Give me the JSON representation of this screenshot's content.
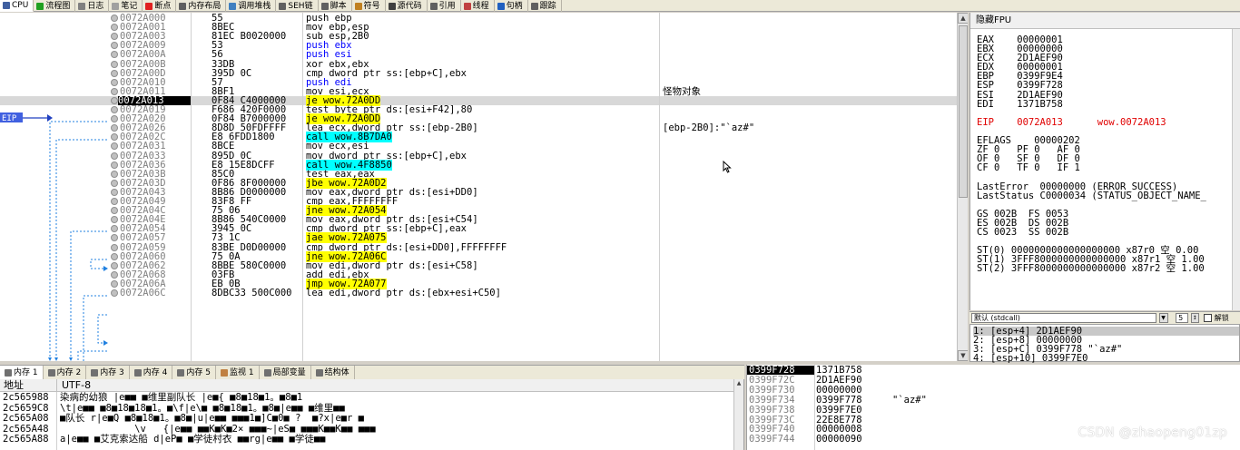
{
  "tabs": [
    {
      "label": "CPU",
      "icon": "cpu-icon",
      "color": "#4060a0"
    },
    {
      "label": "流程图",
      "icon": "graph-icon",
      "color": "#20a020"
    },
    {
      "label": "日志",
      "icon": "log-icon",
      "color": "#808080"
    },
    {
      "label": "笔记",
      "icon": "notes-icon",
      "color": "#a0a0a0"
    },
    {
      "label": "断点",
      "icon": "breakpoint-icon",
      "color": "#e02020"
    },
    {
      "label": "内存布局",
      "icon": "memory-map-icon",
      "color": "#606060"
    },
    {
      "label": "调用堆栈",
      "icon": "callstack-icon",
      "color": "#4080c0"
    },
    {
      "label": "SEH链",
      "icon": "seh-icon",
      "color": "#606060"
    },
    {
      "label": "脚本",
      "icon": "script-icon",
      "color": "#606060"
    },
    {
      "label": "符号",
      "icon": "symbol-icon",
      "color": "#c08020"
    },
    {
      "label": "源代码",
      "icon": "source-icon",
      "color": "#404040"
    },
    {
      "label": "引用",
      "icon": "references-icon",
      "color": "#606060"
    },
    {
      "label": "线程",
      "icon": "threads-icon",
      "color": "#c04040"
    },
    {
      "label": "句柄",
      "icon": "handles-icon",
      "color": "#2060c0"
    },
    {
      "label": "跟踪",
      "icon": "trace-icon",
      "color": "#606060"
    }
  ],
  "disasm": {
    "eip_label": "EIP",
    "rows": [
      {
        "addr": "0072A000",
        "bytes": "55",
        "ins": [
          {
            "t": "push ebp"
          }
        ],
        "comment": ""
      },
      {
        "addr": "0072A001",
        "bytes": "8BEC",
        "ins": [
          {
            "t": "mov ebp,esp"
          }
        ],
        "comment": ""
      },
      {
        "addr": "0072A003",
        "bytes": "81EC B0020000",
        "ins": [
          {
            "t": "sub esp,2B0"
          }
        ],
        "comment": ""
      },
      {
        "addr": "0072A009",
        "bytes": "53",
        "ins": [
          {
            "t": "push ebx",
            "c": "reg"
          }
        ],
        "comment": ""
      },
      {
        "addr": "0072A00A",
        "bytes": "56",
        "ins": [
          {
            "t": "push esi",
            "c": "reg"
          }
        ],
        "comment": ""
      },
      {
        "addr": "0072A00B",
        "bytes": "33DB",
        "ins": [
          {
            "t": "xor ebx,ebx"
          }
        ],
        "comment": ""
      },
      {
        "addr": "0072A00D",
        "bytes": "395D 0C",
        "ins": [
          {
            "t": "cmp dword ptr ss:[ebp+C],ebx"
          }
        ],
        "comment": ""
      },
      {
        "addr": "0072A010",
        "bytes": "57",
        "ins": [
          {
            "t": "push edi",
            "c": "reg"
          }
        ],
        "comment": ""
      },
      {
        "addr": "0072A011",
        "bytes": "8BF1",
        "ins": [
          {
            "t": "mov esi,ecx"
          }
        ],
        "comment": "怪物对象"
      },
      {
        "addr": "0072A013",
        "bytes": "0F84 C4000000",
        "ins": [
          {
            "t": "je",
            "c": "hly"
          },
          {
            "t": " wow.72A0DD",
            "c": "hly"
          }
        ],
        "comment": "",
        "eip": true
      },
      {
        "addr": "0072A019",
        "bytes": "F686 420F0000",
        "ins": [
          {
            "t": "test byte ptr ds:[esi+F42],80"
          }
        ],
        "comment": ""
      },
      {
        "addr": "0072A020",
        "bytes": "0F84 B7000000",
        "ins": [
          {
            "t": "je wow.72A0DD",
            "c": "hly"
          }
        ],
        "comment": ""
      },
      {
        "addr": "0072A026",
        "bytes": "8D8D 50FDFFFF",
        "ins": [
          {
            "t": "lea ecx,dword ptr ss:[ebp-2B0]"
          }
        ],
        "comment": "[ebp-2B0]:\"`az#\""
      },
      {
        "addr": "0072A02C",
        "bytes": "E8 6FDD1800",
        "ins": [
          {
            "t": "call wow.8B7DA0",
            "c": "hlc"
          }
        ],
        "comment": ""
      },
      {
        "addr": "0072A031",
        "bytes": "8BCE",
        "ins": [
          {
            "t": "mov ecx,esi"
          }
        ],
        "comment": ""
      },
      {
        "addr": "0072A033",
        "bytes": "895D 0C",
        "ins": [
          {
            "t": "mov dword ptr ss:[ebp+C],ebx"
          }
        ],
        "comment": ""
      },
      {
        "addr": "0072A036",
        "bytes": "E8 15E8DCFF",
        "ins": [
          {
            "t": "call wow.4F8850",
            "c": "hlc"
          }
        ],
        "comment": ""
      },
      {
        "addr": "0072A03B",
        "bytes": "85C0",
        "ins": [
          {
            "t": "test eax,eax"
          }
        ],
        "comment": ""
      },
      {
        "addr": "0072A03D",
        "bytes": "0F86 8F000000",
        "ins": [
          {
            "t": "jbe wow.72A0D2",
            "c": "hly"
          }
        ],
        "comment": ""
      },
      {
        "addr": "0072A043",
        "bytes": "8B86 D0000000",
        "ins": [
          {
            "t": "mov eax,dword ptr ds:[esi+DD0]"
          }
        ],
        "comment": ""
      },
      {
        "addr": "0072A049",
        "bytes": "83F8 FF",
        "ins": [
          {
            "t": "cmp eax,FFFFFFFF"
          }
        ],
        "comment": ""
      },
      {
        "addr": "0072A04C",
        "bytes": "75 06",
        "ins": [
          {
            "t": "jne wow.72A054",
            "c": "hly"
          }
        ],
        "comment": ""
      },
      {
        "addr": "0072A04E",
        "bytes": "8B86 540C0000",
        "ins": [
          {
            "t": "mov eax,dword ptr ds:[esi+C54]"
          }
        ],
        "comment": ""
      },
      {
        "addr": "0072A054",
        "bytes": "3945 0C",
        "ins": [
          {
            "t": "cmp dword ptr ss:[ebp+C],eax"
          }
        ],
        "comment": ""
      },
      {
        "addr": "0072A057",
        "bytes": "73 1C",
        "ins": [
          {
            "t": "jae wow.72A075",
            "c": "hly"
          }
        ],
        "comment": ""
      },
      {
        "addr": "0072A059",
        "bytes": "83BE D0D00000",
        "ins": [
          {
            "t": "cmp dword ptr ds:[esi+DD0],FFFFFFFF"
          }
        ],
        "comment": ""
      },
      {
        "addr": "0072A060",
        "bytes": "75 0A",
        "ins": [
          {
            "t": "jne wow.72A06C",
            "c": "hly"
          }
        ],
        "comment": ""
      },
      {
        "addr": "0072A062",
        "bytes": "8BBE 580C0000",
        "ins": [
          {
            "t": "mov edi,dword ptr ds:[esi+C58]"
          }
        ],
        "comment": ""
      },
      {
        "addr": "0072A068",
        "bytes": "03FB",
        "ins": [
          {
            "t": "add edi,ebx"
          }
        ],
        "comment": ""
      },
      {
        "addr": "0072A06A",
        "bytes": "EB 0B",
        "ins": [
          {
            "t": "jmp wow.72A077",
            "c": "hly"
          }
        ],
        "comment": ""
      },
      {
        "addr": "0072A06C",
        "bytes": "8DBC33 500C000",
        "ins": [
          {
            "t": "lea edi,dword ptr ds:[ebx+esi+C50]"
          }
        ],
        "comment": ""
      }
    ]
  },
  "registers": {
    "title": "隐藏FPU",
    "lines": [
      "EAX    00000001",
      "EBX    00000000",
      "ECX    2D1AEF90",
      "EDX    00000001",
      "EBP    0399F9E4",
      "ESP    0399F728",
      "ESI    2D1AEF90",
      "EDI    1371B758",
      "",
      "EIP    0072A013      wow.0072A013",
      "",
      "EFLAGS    00000202",
      "ZF 0   PF 0   AF 0",
      "OF 0   SF 0   DF 0",
      "CF 0   TF 0   IF 1",
      "",
      "LastError  00000000 (ERROR_SUCCESS)",
      "LastStatus C0000034 (STATUS_OBJECT_NAME_",
      "",
      "GS 002B  FS 0053",
      "ES 002B  DS 002B",
      "CS 0023  SS 002B",
      "",
      "ST(0) 0000000000000000000 x87r0 空 0.00",
      "ST(1) 3FFF8000000000000000 x87r1 空 1.00",
      "ST(2) 3FFF8000000000000000 x87r2 空 1.00"
    ]
  },
  "stack_args": {
    "convention": "默认 (stdcall)",
    "count": "5",
    "unlock_label": "解锁",
    "lines": [
      "1: [esp+4] 2D1AEF90",
      "2: [esp+8] 00000000",
      "3: [esp+C] 0399F778 \"`az#\"",
      "4: [esp+10] 0399F7E0"
    ]
  },
  "bottom_tabs": [
    {
      "label": "内存 1",
      "icon": "memory-icon"
    },
    {
      "label": "内存 2",
      "icon": "memory-icon"
    },
    {
      "label": "内存 3",
      "icon": "memory-icon"
    },
    {
      "label": "内存 4",
      "icon": "memory-icon"
    },
    {
      "label": "内存 5",
      "icon": "memory-icon"
    },
    {
      "label": "监视 1",
      "icon": "watch-icon"
    },
    {
      "label": "局部变量",
      "icon": "locals-icon"
    },
    {
      "label": "结构体",
      "icon": "struct-icon"
    }
  ],
  "dump": {
    "col_addr": "地址",
    "col_text": "UTF-8",
    "rows": [
      {
        "addr": "2c565988",
        "text": "染病的幼狼 |e■■ ■维里副队长 |e■{ ■8■18■1。■8■1"
      },
      {
        "addr": "2c5659C8",
        "text": "\\t|e■■ ■8■18■18■1。■\\f|e\\■ ■8■18■1。■8■|e■■ ■维里■■"
      },
      {
        "addr": "2c565A08",
        "text": "■队长 r|e■Q ■8■18■1。■8■|u|e■■ ■■■1■]C■0■ ?  ■?x|e■r ■"
      },
      {
        "addr": "2c565A48",
        "text": "             \\v   {|e■■ ■■K■K■2× ■■■~|eS■ ■■■K■■K■■ ■■■"
      },
      {
        "addr": "2c565A88",
        "text": "a|e■■ ■艾克索达船 d|eP■ ■学徒村衣 ■■rg|e■■ ■学徒■■"
      }
    ]
  },
  "stack": {
    "rows": [
      {
        "addr": "0399F728",
        "val": "1371B758",
        "com": "",
        "current": true
      },
      {
        "addr": "0399F72C",
        "val": "2D1AEF90",
        "com": ""
      },
      {
        "addr": "0399F730",
        "val": "00000000",
        "com": ""
      },
      {
        "addr": "0399F734",
        "val": "0399F778",
        "com": "\"`az#\""
      },
      {
        "addr": "0399F738",
        "val": "0399F7E0",
        "com": ""
      },
      {
        "addr": "0399F73C",
        "val": "22E8E778",
        "com": ""
      },
      {
        "addr": "0399F740",
        "val": "00000008",
        "com": ""
      },
      {
        "addr": "0399F744",
        "val": "00000090",
        "com": ""
      }
    ]
  },
  "watermark": "CSDN @zhaopeng01zp"
}
